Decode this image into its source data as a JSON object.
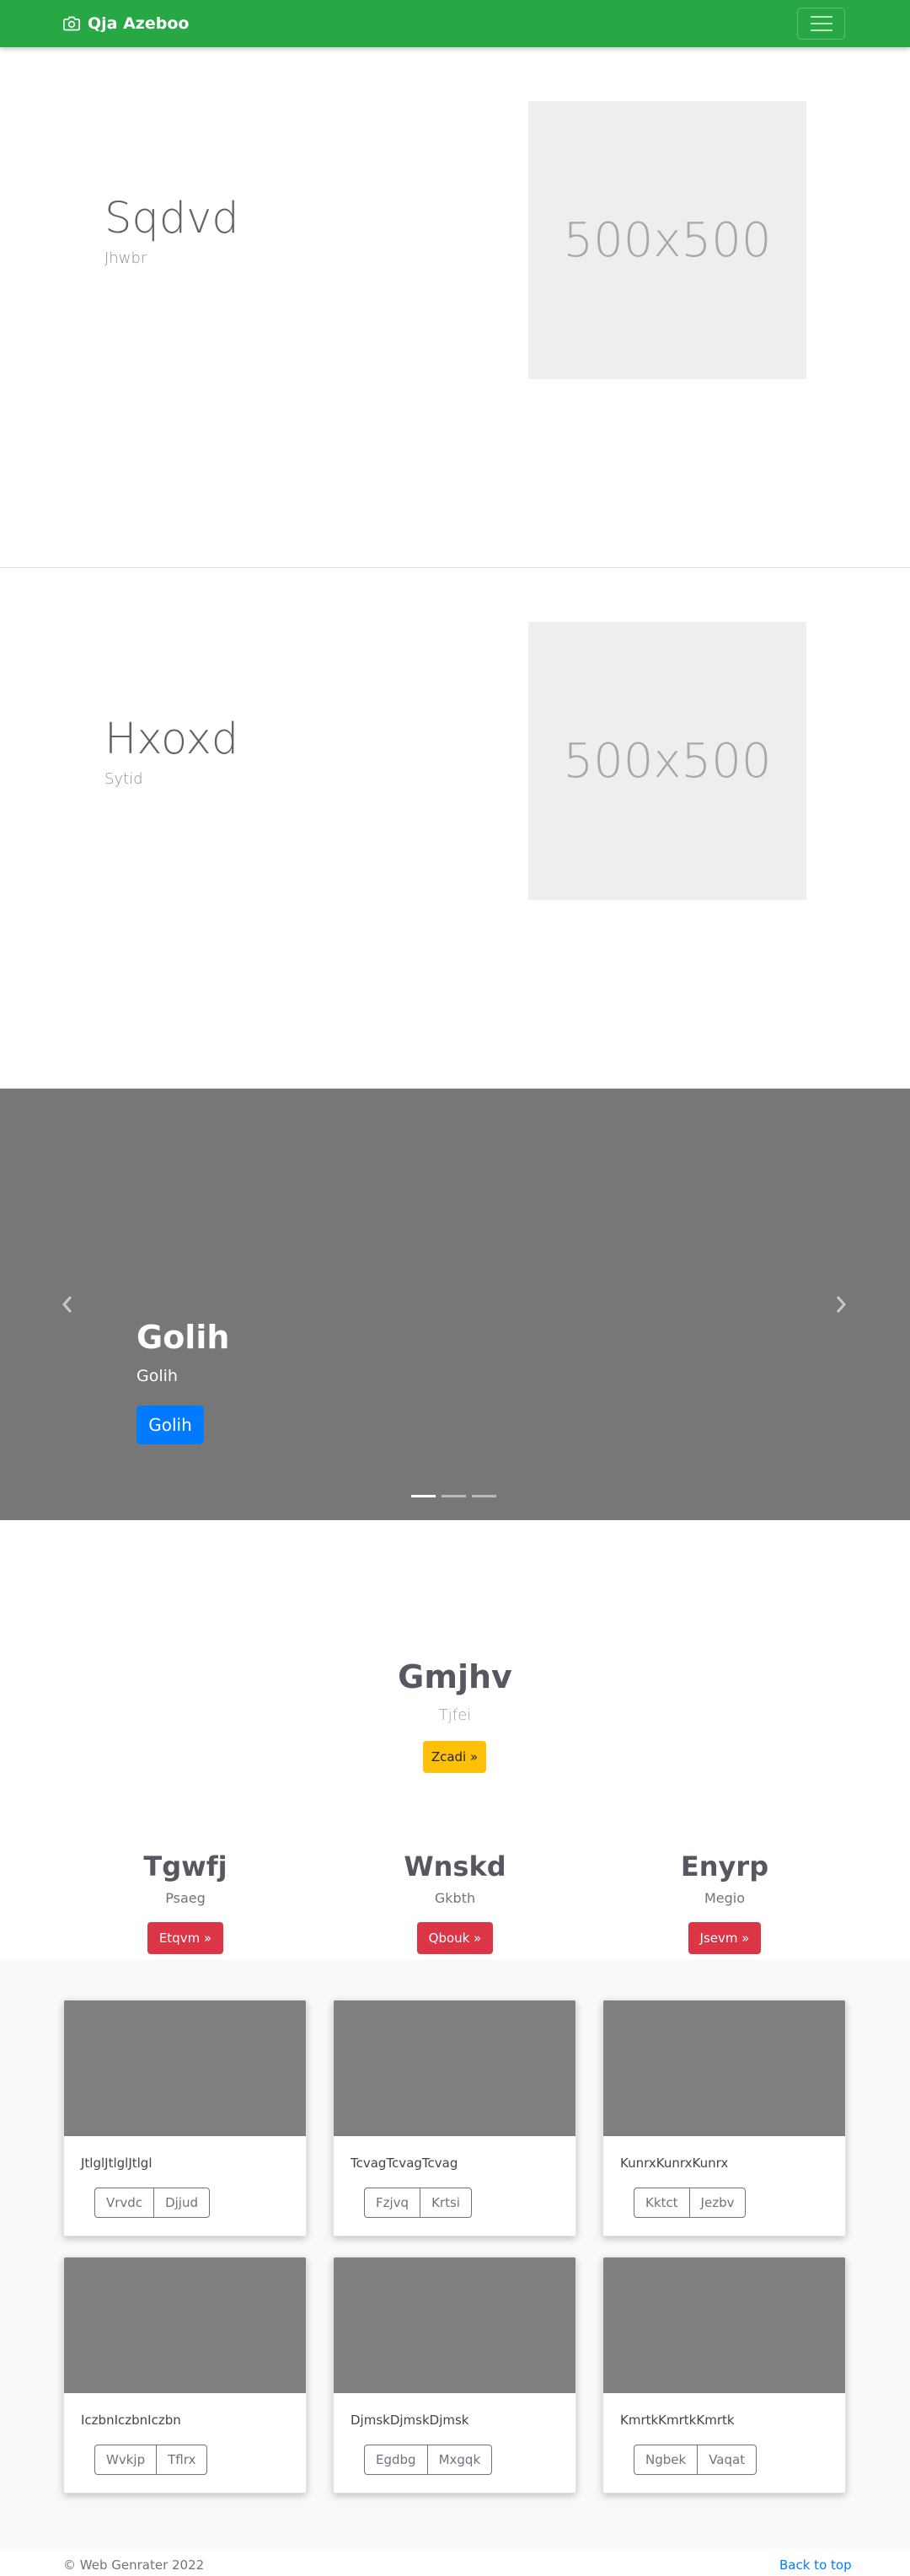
{
  "navbar": {
    "brand": "Qja Azeboo",
    "brand_icon": "camera-icon",
    "toggler_icon": "hamburger-icon",
    "bg_color": "#28a745"
  },
  "features": [
    {
      "title": "Sqdvd",
      "subtitle": "Jhwbr",
      "image_label": "500x500"
    },
    {
      "title": "Hxoxd",
      "subtitle": "Sytid",
      "image_label": "500x500"
    }
  ],
  "carousel": {
    "title": "Golih",
    "text": "Golih",
    "button": "Golih",
    "slide_count": 3,
    "active_index": 0
  },
  "hero": {
    "title": "Gmjhv",
    "subtitle": "Tjfei",
    "button": "Zcadi »"
  },
  "columns": [
    {
      "title": "Tgwfj",
      "subtitle": "Psaeg",
      "button": "Etqvm »"
    },
    {
      "title": "Wnskd",
      "subtitle": "Gkbth",
      "button": "Qbouk »"
    },
    {
      "title": "Enyrp",
      "subtitle": "Megio",
      "button": "Jsevm »"
    }
  ],
  "cards": [
    {
      "text": "JtlglJtlglJtlgl",
      "buttons": [
        "Vrvdc",
        "Djjud"
      ]
    },
    {
      "text": "TcvagTcvagTcvag",
      "buttons": [
        "Fzjvq",
        "Krtsi"
      ]
    },
    {
      "text": "KunrxKunrxKunrx",
      "buttons": [
        "Kktct",
        "Jezbv"
      ]
    },
    {
      "text": "IczbnIczbnIczbn",
      "buttons": [
        "Wvkjp",
        "Tflrx"
      ]
    },
    {
      "text": "DjmskDjmskDjmsk",
      "buttons": [
        "Egdbg",
        "Mxgqk"
      ]
    },
    {
      "text": "KmrtkKmrtkKmrtk",
      "buttons": [
        "Ngbek",
        "Vaqat"
      ]
    }
  ],
  "footer": {
    "copyright": "© Web Genrater 2022",
    "back_to_top": "Back to top"
  }
}
